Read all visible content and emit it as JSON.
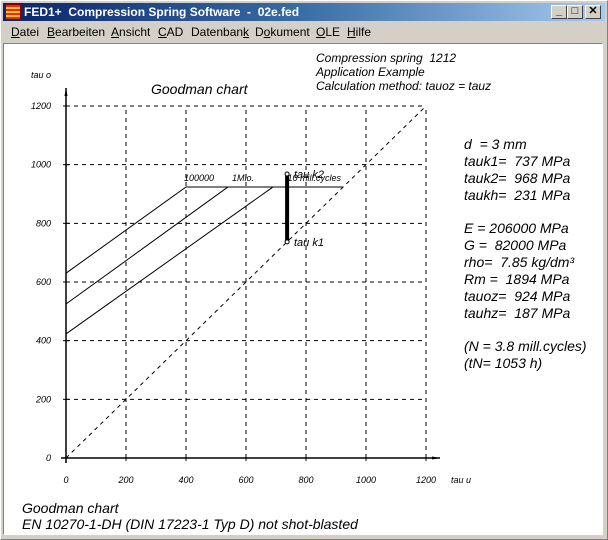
{
  "window": {
    "title": "FED1+  Compression Spring Software  -  02e.fed",
    "controls": {
      "minimize": "_",
      "maximize": "□",
      "close": "✕"
    }
  },
  "menu": [
    {
      "label": "Datei",
      "accel": "D"
    },
    {
      "label": "Bearbeiten",
      "accel": "B"
    },
    {
      "label": "Ansicht",
      "accel": "A"
    },
    {
      "label": "CAD",
      "accel": "C"
    },
    {
      "label": "Datenbank",
      "accel": "k"
    },
    {
      "label": "Dokument",
      "accel": "o"
    },
    {
      "label": "OLE",
      "accel": "O"
    },
    {
      "label": "Hilfe",
      "accel": "H"
    }
  ],
  "header_info": {
    "line1": "Compression spring  1212",
    "line2": "Application Example",
    "line3": "Calculation method: tauoz = tauz"
  },
  "params": {
    "d": "d  = 3 mm",
    "tauk1": "tauk1=  737 MPa",
    "tauk2": "tauk2=  968 MPa",
    "taukh": "taukh=  231 MPa",
    "E": "E = 206000 MPa",
    "G": "G =  82000 MPa",
    "rho": "rho=  7.85 kg/dm³",
    "Rm": "Rm =  1894 MPa",
    "tauoz": "tauoz=  924 MPa",
    "tauhz": "tauhz=  187 MPa",
    "N": "(N = 3.8 mill.cycles)",
    "tN": "(tN= 1053 h)"
  },
  "caption": {
    "line1": "Goodman chart",
    "line2": "EN 10270-1-DH (DIN 17223-1 Typ D) not shot-blasted"
  },
  "chart_data": {
    "type": "line",
    "title": "Goodman chart",
    "xlabel": "tau u",
    "ylabel": "tau o",
    "xlim": [
      0,
      1200
    ],
    "ylim": [
      0,
      1200
    ],
    "xticks": [
      0,
      200,
      400,
      600,
      800,
      1000,
      1200
    ],
    "yticks": [
      0,
      200,
      400,
      600,
      800,
      1000,
      1200
    ],
    "grid": true,
    "series": [
      {
        "name": "100000",
        "points": [
          [
            0,
            630
          ],
          [
            400,
            924
          ],
          [
            925,
            924
          ]
        ]
      },
      {
        "name": "1Mio.",
        "points": [
          [
            0,
            525
          ],
          [
            540,
            924
          ]
        ]
      },
      {
        "name": "10 mill.cycles",
        "points": [
          [
            0,
            423
          ],
          [
            690,
            924
          ]
        ]
      },
      {
        "name": "diagonal",
        "style": "dashed",
        "points": [
          [
            0,
            0
          ],
          [
            1200,
            1200
          ]
        ]
      },
      {
        "name": "stress stroke",
        "style": "thick",
        "points": [
          [
            737,
            737
          ],
          [
            737,
            968
          ]
        ]
      }
    ],
    "annotations": [
      {
        "text": "100000",
        "x": 400,
        "y": 924
      },
      {
        "text": "1Mio.",
        "x": 560,
        "y": 924
      },
      {
        "text": "10 mill.cycles",
        "x": 745,
        "y": 924
      },
      {
        "text": "tau k2",
        "x": 760,
        "y": 968
      },
      {
        "text": "tau k1",
        "x": 760,
        "y": 737
      }
    ]
  }
}
